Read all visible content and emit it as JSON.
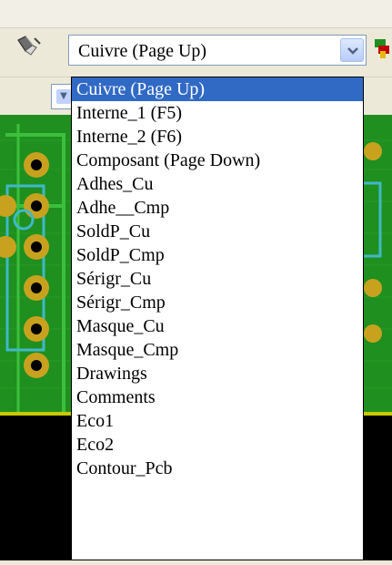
{
  "toolbar": {
    "tool_icon": "eraser-cursor-icon",
    "right_icon": "layer-color-icon",
    "layer_select": {
      "value": "Cuivre (Page Up)",
      "arrow_icon": "chevron-down-icon"
    }
  },
  "dropdown": {
    "selected_index": 0,
    "highlight_color": "#316ac5",
    "options": [
      "Cuivre (Page Up)",
      "Interne_1 (F5)",
      "Interne_2 (F6)",
      "Composant (Page Down)",
      "Adhes_Cu",
      "Adhe__Cmp",
      "SoldP_Cu",
      "SoldP_Cmp",
      "Sérigr_Cu",
      "Sérigr_Cmp",
      "Masque_Cu",
      "Masque_Cmp",
      "Drawings",
      "Comments",
      "Eco1",
      "Eco2",
      "Contour_Pcb"
    ]
  },
  "colors": {
    "board_green": "#1f8f1f",
    "pad_yellow": "#c8a21e",
    "trace_cyan": "#40b8c8",
    "combo_border": "#7f9db9"
  }
}
